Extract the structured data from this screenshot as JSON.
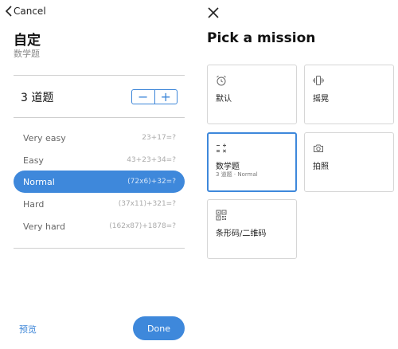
{
  "left": {
    "cancel_label": "Cancel",
    "title": "自定",
    "subtitle": "数学题",
    "count_label": "3 道题",
    "stepper": {
      "minus": "−",
      "plus": "+"
    },
    "difficulties": [
      {
        "label": "Very easy",
        "example": "23+17=?",
        "selected": false
      },
      {
        "label": "Easy",
        "example": "43+23+34=?",
        "selected": false
      },
      {
        "label": "Normal",
        "example": "(72x6)+32=?",
        "selected": true
      },
      {
        "label": "Hard",
        "example": "(37x11)+321=?",
        "selected": false
      },
      {
        "label": "Very hard",
        "example": "(162x87)+1878=?",
        "selected": false
      }
    ],
    "preview_label": "预览",
    "done_label": "Done"
  },
  "right": {
    "title": "Pick a mission",
    "missions": [
      {
        "name": "默认",
        "icon": "alarm-clock-icon",
        "subtitle": ""
      },
      {
        "name": "摇晃",
        "icon": "phone-vibrate-icon",
        "subtitle": ""
      },
      {
        "name": "数学题",
        "icon": "math-operators-icon",
        "subtitle": "3 道题 · Normal"
      },
      {
        "name": "拍照",
        "icon": "camera-icon",
        "subtitle": ""
      },
      {
        "name": "条形码/二维码",
        "icon": "qr-code-icon",
        "subtitle": ""
      }
    ]
  },
  "colors": {
    "accent": "#3e88db",
    "divider": "#cfcfcf"
  }
}
